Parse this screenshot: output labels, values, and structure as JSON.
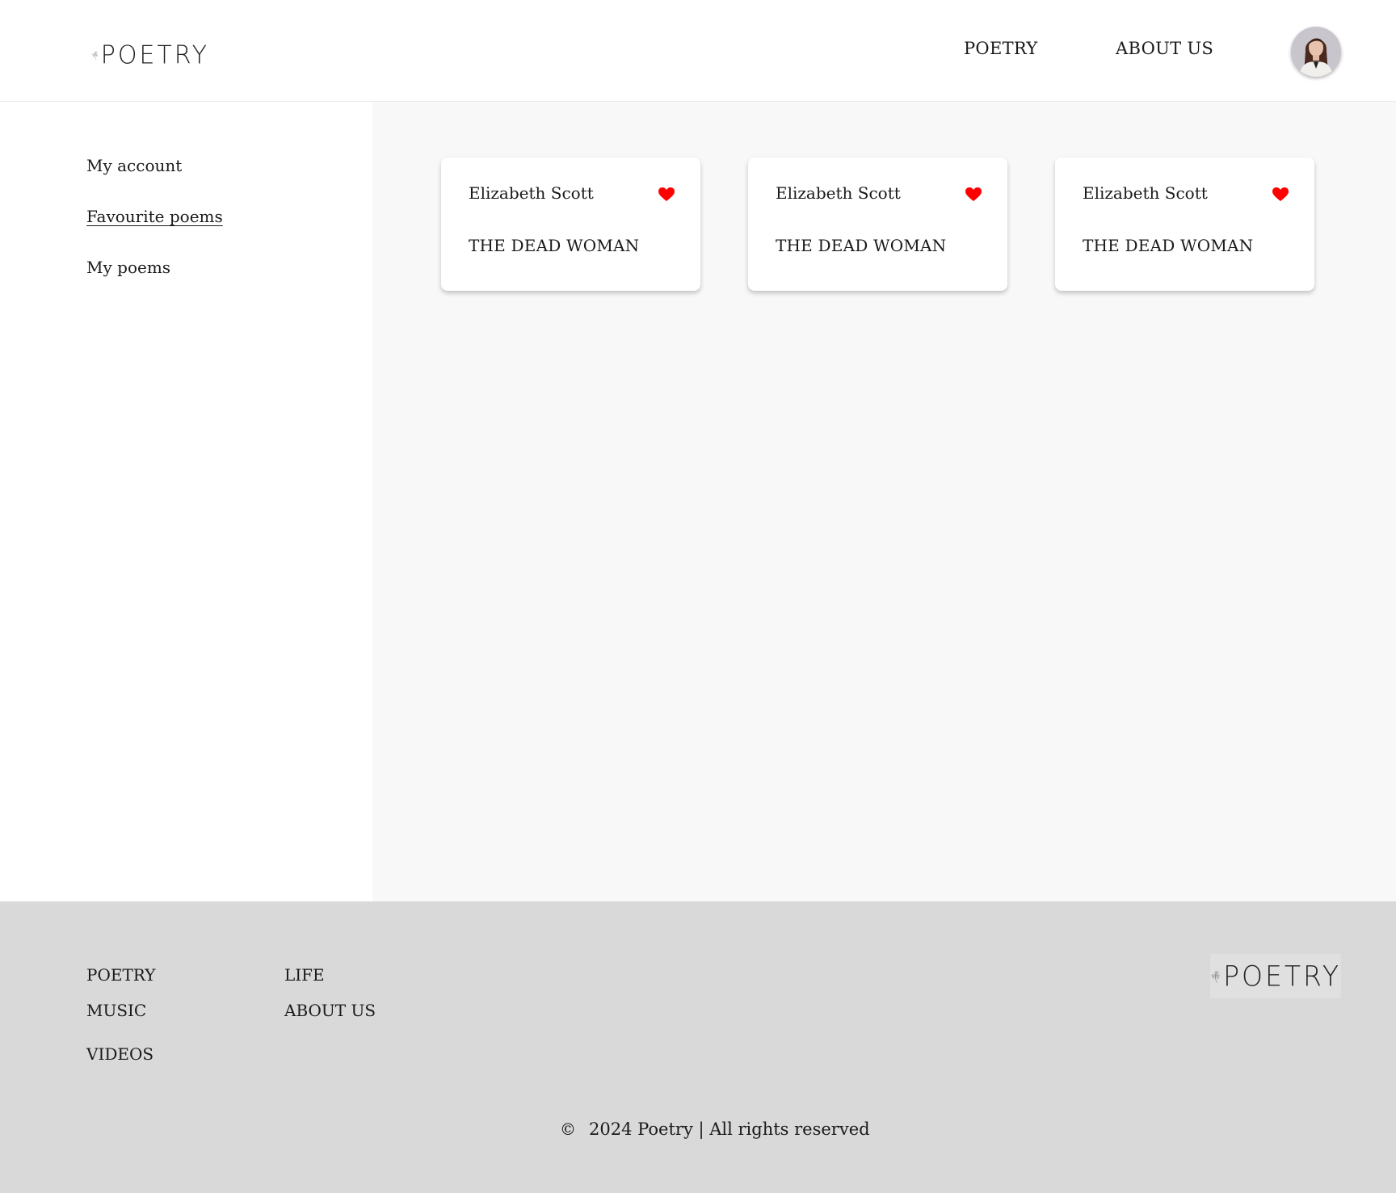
{
  "header": {
    "logo_text": "POETRY",
    "nav": [
      {
        "label": "POETRY"
      },
      {
        "label": "ABOUT US"
      }
    ]
  },
  "sidebar": {
    "items": [
      {
        "label": "My account",
        "active": false
      },
      {
        "label": "Favourite poems",
        "active": true
      },
      {
        "label": "My poems",
        "active": false
      }
    ]
  },
  "cards": [
    {
      "author": "Elizabeth Scott",
      "title": "THE DEAD WOMAN",
      "favourited": true,
      "icon": "heart-icon"
    },
    {
      "author": "Elizabeth Scott",
      "title": "THE DEAD WOMAN",
      "favourited": true,
      "icon": "heart-icon"
    },
    {
      "author": "Elizabeth Scott",
      "title": "THE DEAD WOMAN",
      "favourited": true,
      "icon": "heart-icon"
    }
  ],
  "footer": {
    "links": [
      {
        "label": "POETRY"
      },
      {
        "label": "MUSIC"
      },
      {
        "label": "VIDEOS"
      },
      {
        "label": "LIFE"
      },
      {
        "label": "ABOUT US"
      }
    ],
    "logo_text": "POETRY",
    "copyright_symbol": "©",
    "copyright_text": "2024 Poetry | All rights reserved"
  },
  "colors": {
    "heart": "#ff0000",
    "main_bg": "#f8f8f8",
    "footer_bg": "#d9d9d9"
  }
}
